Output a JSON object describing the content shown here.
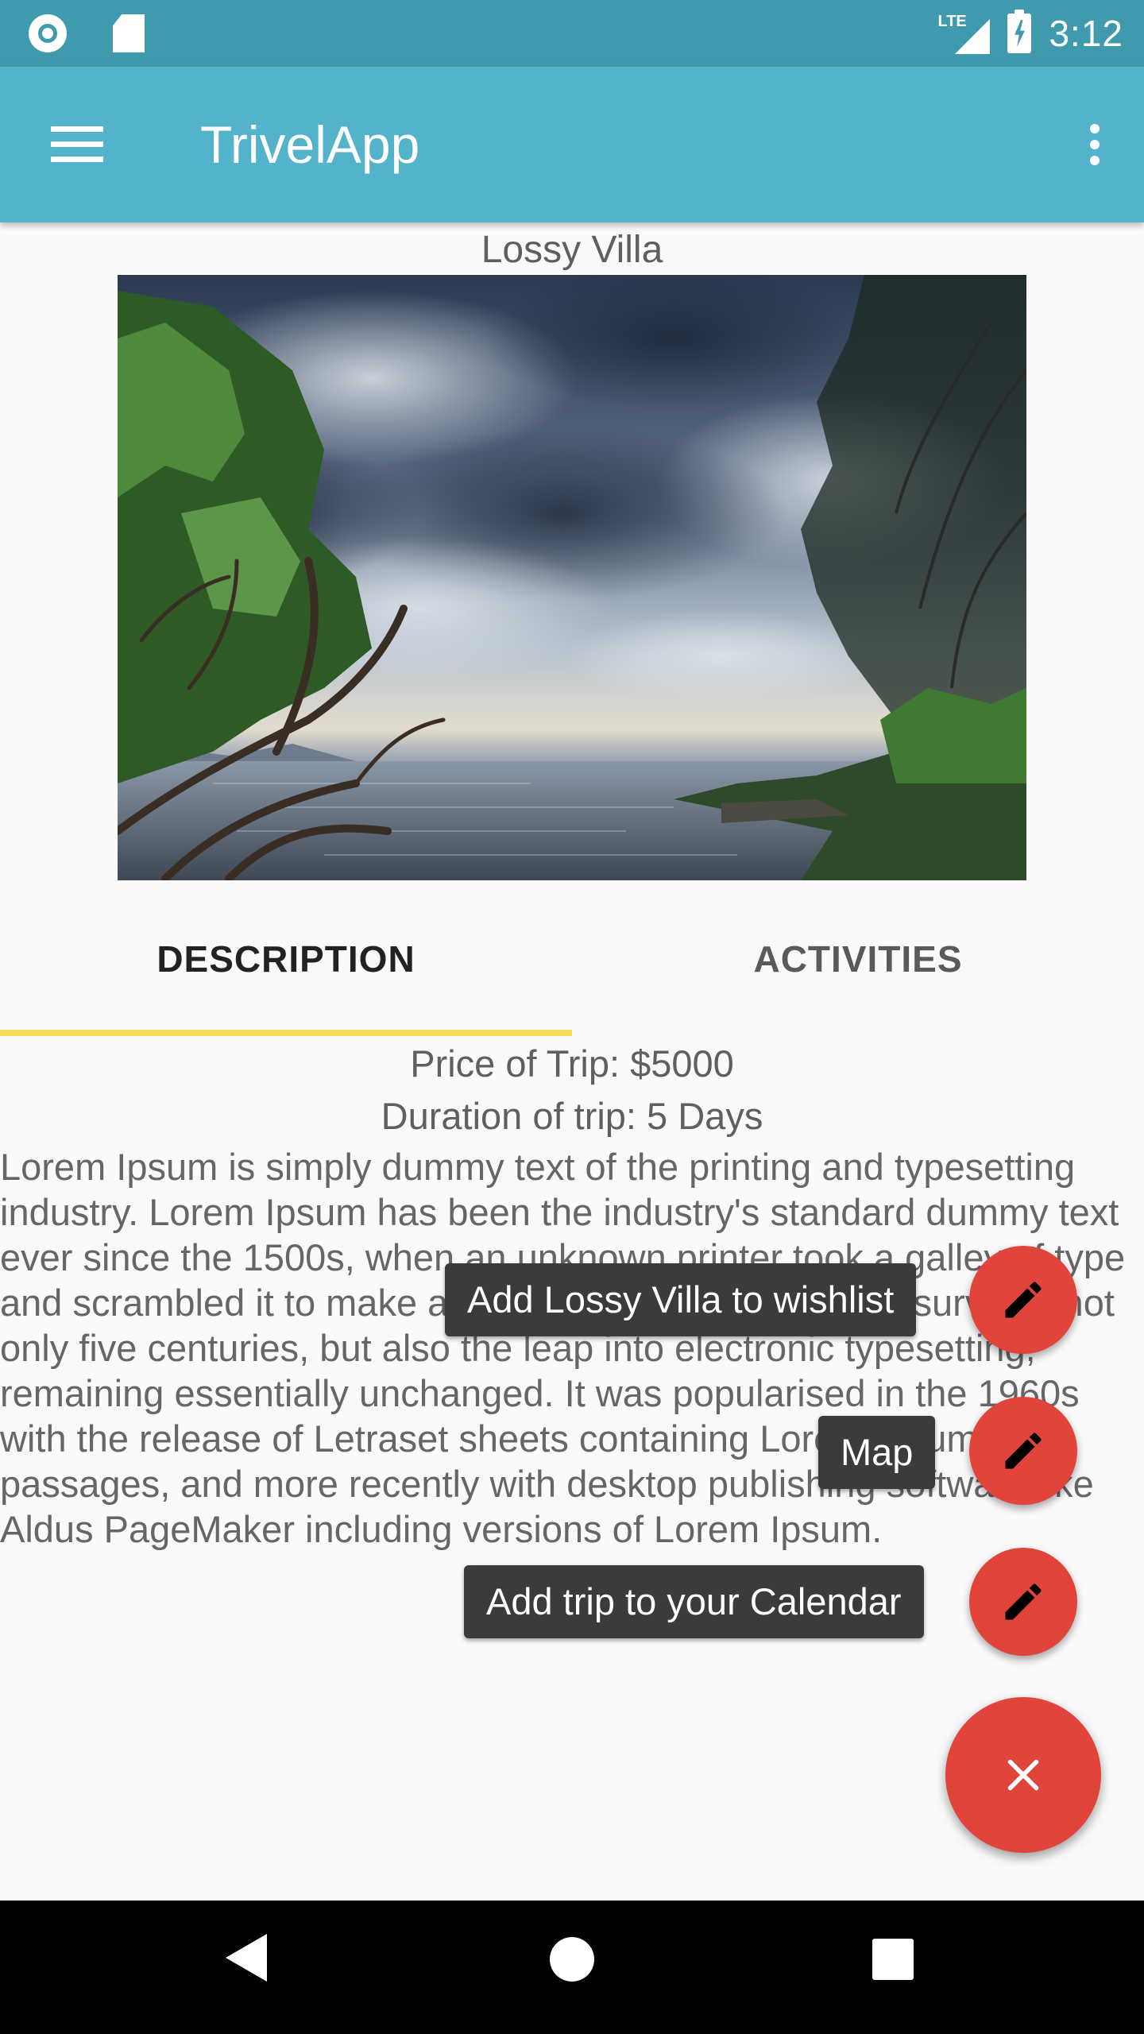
{
  "status_bar": {
    "network_label": "LTE",
    "time": "3:12",
    "icons": [
      "record-icon",
      "sd-card-icon",
      "signal-icon",
      "battery-charging-icon"
    ]
  },
  "app_bar": {
    "title": "TrivelApp",
    "menu_icon": "hamburger-menu-icon",
    "overflow_icon": "more-vert-icon",
    "color": "#52b3cb"
  },
  "place": {
    "name": "Lossy Villa"
  },
  "tabs": [
    {
      "label": "DESCRIPTION",
      "selected": true
    },
    {
      "label": "ACTIVITIES",
      "selected": false
    }
  ],
  "trip": {
    "price": "Price of Trip: $5000",
    "duration": "Duration of trip: 5 Days",
    "description": "Lorem Ipsum is simply dummy text of the printing and typesetting industry. Lorem Ipsum has been the industry's standard dummy text ever since the 1500s, when an unknown printer took a galley of type and scrambled it to make a type specimen book. It has survived not only five centuries, but also the leap into electronic typesetting, remaining essentially unchanged. It was popularised in the 1960s with the release of Letraset sheets containing Lorem Ipsum passages, and more recently with desktop publishing software like Aldus PageMaker including versions of Lorem Ipsum."
  },
  "fab_menu": {
    "actions": [
      {
        "label": "Add Lossy Villa to wishlist",
        "icon": "pencil-icon"
      },
      {
        "label": "Map",
        "icon": "pencil-icon"
      },
      {
        "label": "Add trip to your Calendar",
        "icon": "pencil-icon"
      }
    ],
    "main_icon": "close-icon",
    "accent": "#e0443a",
    "indicator_color": "#f4de5a"
  },
  "nav_bar": {
    "icons": [
      "back-icon",
      "home-icon",
      "recents-icon"
    ]
  }
}
